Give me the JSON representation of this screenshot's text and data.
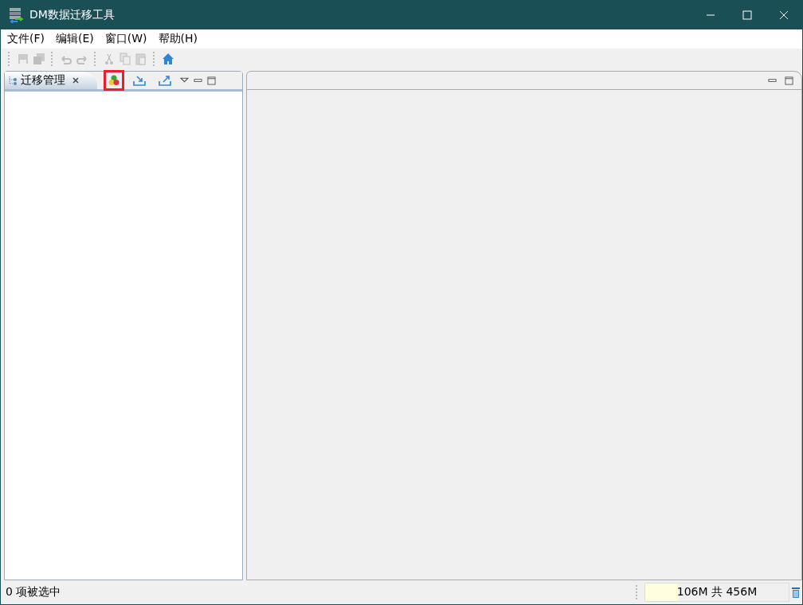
{
  "window": {
    "title": "DM数据迁移工具"
  },
  "menu": [
    "文件(F)",
    "编辑(E)",
    "窗口(W)",
    "帮助(H)"
  ],
  "toolbar": [
    {
      "kind": "save",
      "disabled": true
    },
    {
      "kind": "save-all",
      "disabled": true
    },
    {
      "kind": "sep"
    },
    {
      "kind": "undo",
      "disabled": true
    },
    {
      "kind": "redo",
      "disabled": true
    },
    {
      "kind": "sep"
    },
    {
      "kind": "cut",
      "disabled": true
    },
    {
      "kind": "copy",
      "disabled": true
    },
    {
      "kind": "paste",
      "disabled": true
    },
    {
      "kind": "sep"
    },
    {
      "kind": "home",
      "disabled": false
    }
  ],
  "left_panel": {
    "tab": {
      "label": "迁移管理",
      "selected": true
    },
    "actions": [
      {
        "kind": "circles",
        "highlighted": true
      },
      {
        "kind": "import",
        "highlighted": false
      },
      {
        "kind": "export",
        "highlighted": false
      }
    ]
  },
  "status_bar": {
    "text": "0 项被选中",
    "heap": {
      "reading": "106M 共 456M",
      "level": 0.23
    }
  }
}
